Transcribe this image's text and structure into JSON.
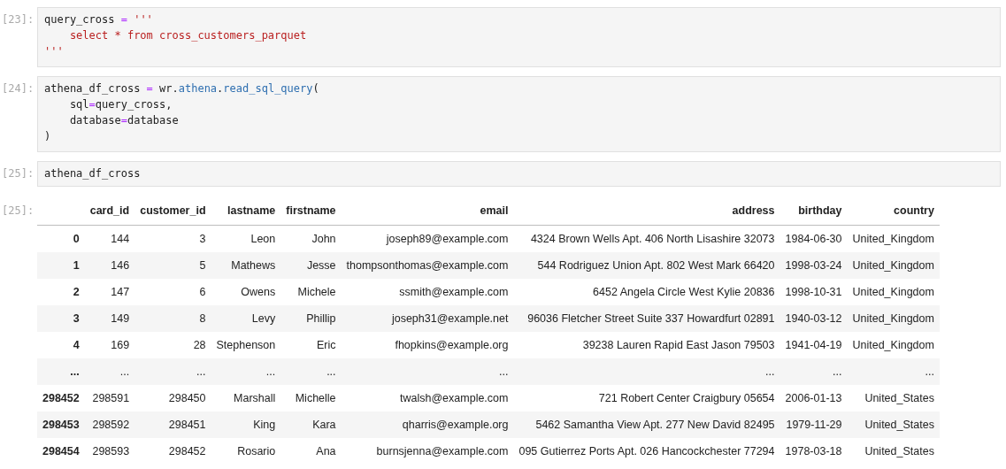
{
  "cells": [
    {
      "prompt": "[23]:",
      "lines": [
        [
          {
            "kind": "name",
            "text": "query_cross "
          },
          {
            "kind": "op",
            "text": "="
          },
          {
            "kind": "string",
            "text": " '''"
          }
        ],
        [
          {
            "kind": "string",
            "text": "    select * from cross_customers_parquet"
          }
        ],
        [
          {
            "kind": "string",
            "text": "'''"
          }
        ]
      ]
    },
    {
      "prompt": "[24]:",
      "lines": [
        [
          {
            "kind": "name",
            "text": "athena_df_cross "
          },
          {
            "kind": "op",
            "text": "="
          },
          {
            "kind": "name",
            "text": " wr."
          },
          {
            "kind": "attr",
            "text": "athena"
          },
          {
            "kind": "name",
            "text": "."
          },
          {
            "kind": "attr",
            "text": "read_sql_query"
          },
          {
            "kind": "name",
            "text": "("
          }
        ],
        [
          {
            "kind": "name",
            "text": "    sql"
          },
          {
            "kind": "op",
            "text": "="
          },
          {
            "kind": "name",
            "text": "query_cross,"
          }
        ],
        [
          {
            "kind": "name",
            "text": "    database"
          },
          {
            "kind": "op",
            "text": "="
          },
          {
            "kind": "name",
            "text": "database"
          }
        ],
        [
          {
            "kind": "name",
            "text": ")"
          }
        ]
      ]
    },
    {
      "prompt": "[25]:",
      "lines": [
        [
          {
            "kind": "name",
            "text": "athena_df_cross"
          }
        ]
      ]
    }
  ],
  "output": {
    "prompt": "[25]:",
    "table": {
      "columns": [
        "card_id",
        "customer_id",
        "lastname",
        "firstname",
        "email",
        "address",
        "birthday",
        "country"
      ],
      "rows": [
        {
          "index": "0",
          "cells": [
            "144",
            "3",
            "Leon",
            "John",
            "joseph89@example.com",
            "4324 Brown Wells Apt. 406 North Lisashire 32073",
            "1984-06-30",
            "United_Kingdom"
          ]
        },
        {
          "index": "1",
          "cells": [
            "146",
            "5",
            "Mathews",
            "Jesse",
            "thompsonthomas@example.com",
            "544 Rodriguez Union Apt. 802 West Mark 66420",
            "1998-03-24",
            "United_Kingdom"
          ]
        },
        {
          "index": "2",
          "cells": [
            "147",
            "6",
            "Owens",
            "Michele",
            "ssmith@example.com",
            "6452 Angela Circle West Kylie 20836",
            "1998-10-31",
            "United_Kingdom"
          ]
        },
        {
          "index": "3",
          "cells": [
            "149",
            "8",
            "Levy",
            "Phillip",
            "joseph31@example.net",
            "96036 Fletcher Street Suite 337 Howardfurt 02891",
            "1940-03-12",
            "United_Kingdom"
          ]
        },
        {
          "index": "4",
          "cells": [
            "169",
            "28",
            "Stephenson",
            "Eric",
            "fhopkins@example.org",
            "39238 Lauren Rapid East Jason 79503",
            "1941-04-19",
            "United_Kingdom"
          ]
        },
        {
          "index": "...",
          "cells": [
            "...",
            "...",
            "...",
            "...",
            "...",
            "...",
            "...",
            "..."
          ]
        },
        {
          "index": "298452",
          "cells": [
            "298591",
            "298450",
            "Marshall",
            "Michelle",
            "twalsh@example.com",
            "721 Robert Center Craigbury 05654",
            "2006-01-13",
            "United_States"
          ]
        },
        {
          "index": "298453",
          "cells": [
            "298592",
            "298451",
            "King",
            "Kara",
            "qharris@example.org",
            "5462 Samantha View Apt. 277 New David 82495",
            "1979-11-29",
            "United_States"
          ]
        },
        {
          "index": "298454",
          "cells": [
            "298593",
            "298452",
            "Rosario",
            "Ana",
            "burnsjenna@example.com",
            "095 Gutierrez Ports Apt. 026 Hancockchester 77294",
            "1978-03-18",
            "United_States"
          ]
        }
      ]
    }
  }
}
